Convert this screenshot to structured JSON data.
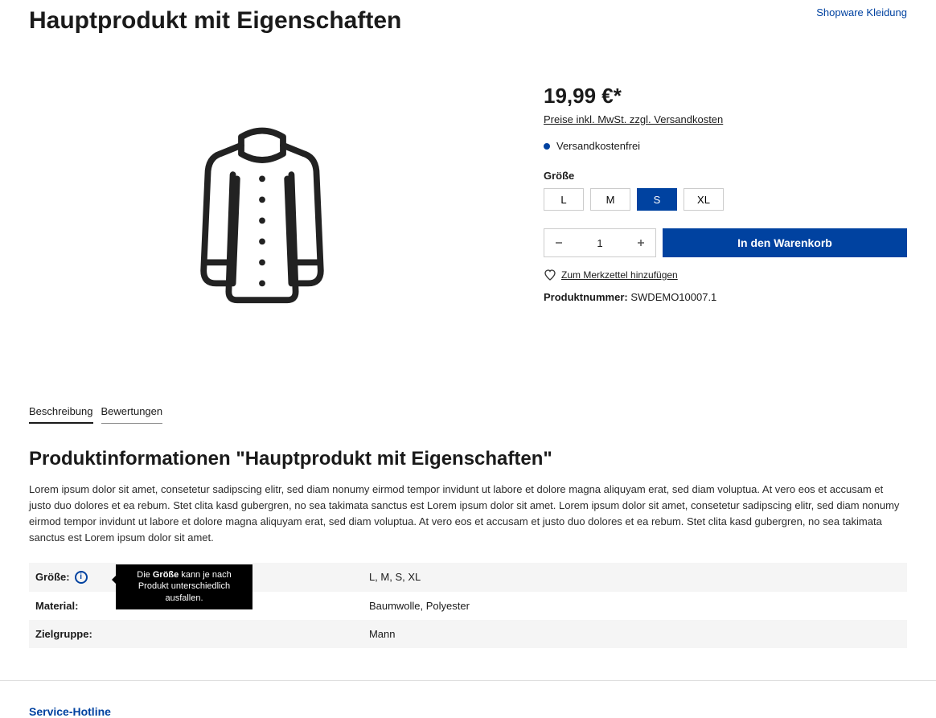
{
  "header": {
    "title": "Hauptprodukt mit Eigenschaften",
    "brand": "Shopware Kleidung"
  },
  "price": "19,99 €*",
  "taxInfo": "Preise inkl. MwSt. zzgl. Versandkosten",
  "shippingFree": "Versandkostenfrei",
  "variant": {
    "label": "Größe",
    "options": [
      "L",
      "M",
      "S",
      "XL"
    ],
    "selected": "S"
  },
  "quantity": "1",
  "addToCart": "In den Warenkorb",
  "wishlist": "Zum Merkzettel hinzufügen",
  "sku": {
    "label": "Produktnummer:",
    "value": "SWDEMO10007.1"
  },
  "tabs": [
    "Beschreibung",
    "Bewertungen"
  ],
  "infoTitle": "Produktinformationen \"Hauptprodukt mit Eigenschaften\"",
  "description": "Lorem ipsum dolor sit amet, consetetur sadipscing elitr, sed diam nonumy eirmod tempor invidunt ut labore et dolore magna aliquyam erat, sed diam voluptua. At vero eos et accusam et justo duo dolores et ea rebum. Stet clita kasd gubergren, no sea takimata sanctus est Lorem ipsum dolor sit amet. Lorem ipsum dolor sit amet, consetetur sadipscing elitr, sed diam nonumy eirmod tempor invidunt ut labore et dolore magna aliquyam erat, sed diam voluptua. At vero eos et accusam et justo duo dolores et ea rebum. Stet clita kasd gubergren, no sea takimata sanctus est Lorem ipsum dolor sit amet.",
  "properties": [
    {
      "key": "Größe:",
      "value": "L, M, S, XL",
      "hasTooltip": true
    },
    {
      "key": "Material:",
      "value": "Baumwolle, Polyester"
    },
    {
      "key": "Zielgruppe:",
      "value": "Mann"
    }
  ],
  "tooltip": {
    "prefix": "Die ",
    "bold": "Größe",
    "suffix": " kann je nach Produkt unterschiedlich ausfallen."
  },
  "footer": {
    "hotline": "Service-Hotline"
  }
}
